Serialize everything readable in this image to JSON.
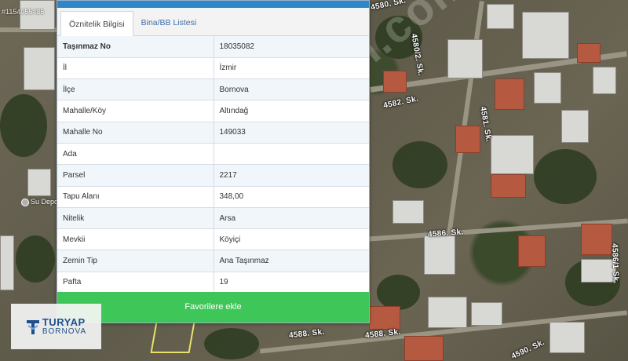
{
  "colors": {
    "header_bar": "#2f86c8",
    "favorite_button": "#3fc659",
    "row_alt": "#f1f6fb",
    "logo_blue": "#1d4f8f"
  },
  "map": {
    "listing_id_watermark": "#1154055485",
    "site_watermark": "sahibinden.com",
    "poi_label": "Su Deposu",
    "streets": [
      "4580. Sk.",
      "4580/2. Sk.",
      "4582. Sk.",
      "4581. Sk.",
      "4586. Sk.",
      "4588. Sk.",
      "4588. Sk.",
      "4590. Sk.",
      "4586/1 Sk."
    ]
  },
  "panel": {
    "tabs": [
      {
        "label": "Öznitelik Bilgisi",
        "active": true
      },
      {
        "label": "Bina/BB Listesi",
        "active": false
      }
    ],
    "rows": [
      {
        "key": "Taşınmaz No",
        "value": "18035082"
      },
      {
        "key": "İl",
        "value": "İzmir"
      },
      {
        "key": "İlçe",
        "value": "Bornova"
      },
      {
        "key": "Mahalle/Köy",
        "value": "Altındağ"
      },
      {
        "key": "Mahalle No",
        "value": "149033"
      },
      {
        "key": "Ada",
        "value": ""
      },
      {
        "key": "Parsel",
        "value": "2217"
      },
      {
        "key": "Tapu Alanı",
        "value": "348,00"
      },
      {
        "key": "Nitelik",
        "value": "Arsa"
      },
      {
        "key": "Mevkii",
        "value": "Köyiçi"
      },
      {
        "key": "Zemin Tip",
        "value": "Ana Taşınmaz"
      },
      {
        "key": "Pafta",
        "value": "19"
      }
    ],
    "favorite_label": "Favorilere ekle"
  },
  "logo": {
    "line1": "TURYAP",
    "line2": "BORNOVA"
  }
}
